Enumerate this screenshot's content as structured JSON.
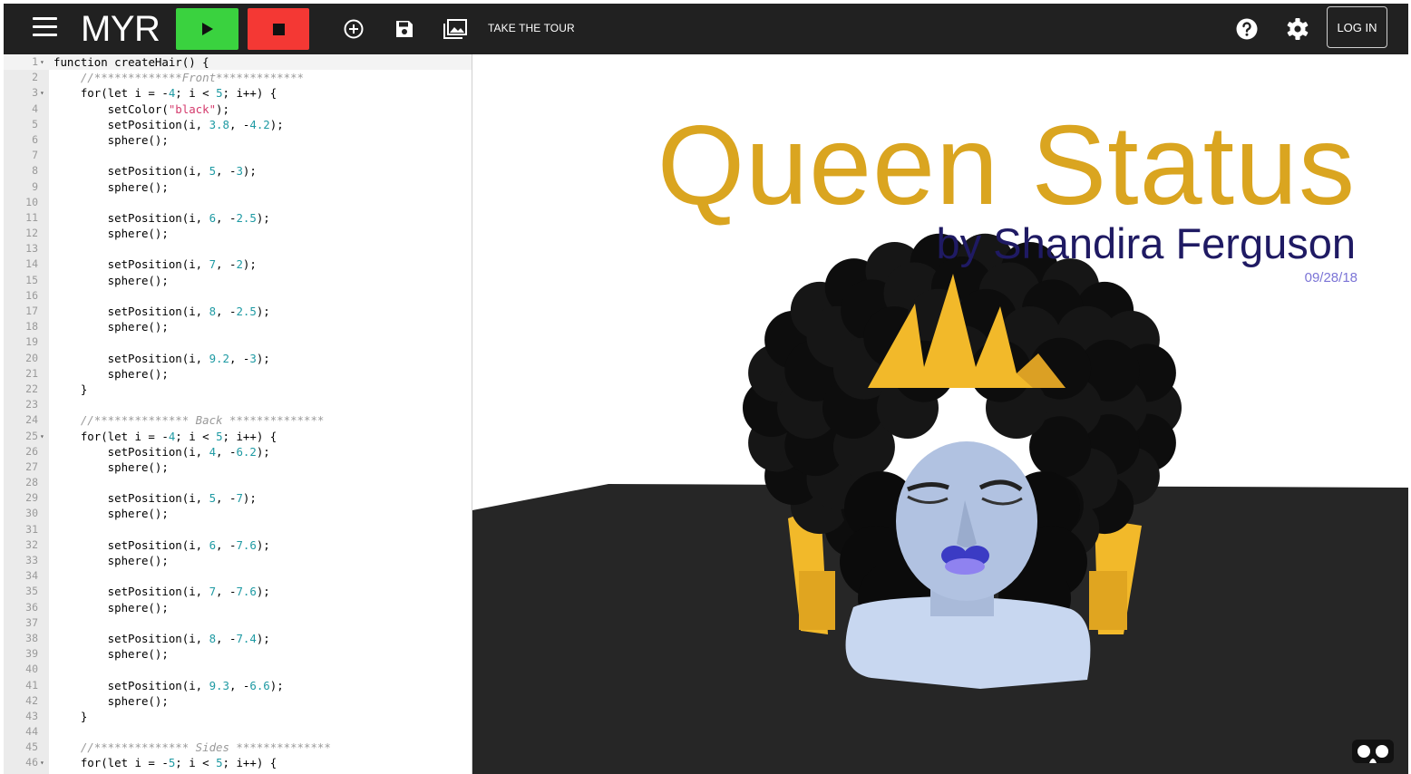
{
  "app": {
    "logo_text": "MYR"
  },
  "toolbar": {
    "menu_icon": "hamburger-menu-icon",
    "play_icon": "play-icon",
    "stop_icon": "stop-icon",
    "new_icon": "add-circle-icon",
    "save_icon": "floppy-disk-icon",
    "collection_icon": "photo-library-icon",
    "tour_label": "TAKE THE TOUR",
    "help_icon": "help-circle-icon",
    "settings_icon": "gear-icon",
    "login_label": "LOG IN",
    "colors": {
      "play": "#3ad23f",
      "stop": "#f43834",
      "bar": "#212121"
    }
  },
  "editor": {
    "active_line": 1,
    "folded_lines": [
      1,
      3,
      25,
      46
    ],
    "lines": [
      [
        [
          "kw",
          "function"
        ],
        [
          "t",
          " createHair() {"
        ]
      ],
      [
        [
          "t",
          "    "
        ],
        [
          "com",
          "//*************Front*************"
        ]
      ],
      [
        [
          "t",
          "    for(let i = -"
        ],
        [
          "num",
          "4"
        ],
        [
          "t",
          "; i < "
        ],
        [
          "num",
          "5"
        ],
        [
          "t",
          "; i++) {"
        ]
      ],
      [
        [
          "t",
          "        setColor("
        ],
        [
          "str",
          "\"black\""
        ],
        [
          "t",
          ");"
        ]
      ],
      [
        [
          "t",
          "        setPosition(i, "
        ],
        [
          "num",
          "3.8"
        ],
        [
          "t",
          ", -"
        ],
        [
          "num",
          "4.2"
        ],
        [
          "t",
          ");"
        ]
      ],
      [
        [
          "t",
          "        sphere();"
        ]
      ],
      [],
      [
        [
          "t",
          "        setPosition(i, "
        ],
        [
          "num",
          "5"
        ],
        [
          "t",
          ", -"
        ],
        [
          "num",
          "3"
        ],
        [
          "t",
          ");"
        ]
      ],
      [
        [
          "t",
          "        sphere();"
        ]
      ],
      [],
      [
        [
          "t",
          "        setPosition(i, "
        ],
        [
          "num",
          "6"
        ],
        [
          "t",
          ", -"
        ],
        [
          "num",
          "2.5"
        ],
        [
          "t",
          ");"
        ]
      ],
      [
        [
          "t",
          "        sphere();"
        ]
      ],
      [],
      [
        [
          "t",
          "        setPosition(i, "
        ],
        [
          "num",
          "7"
        ],
        [
          "t",
          ", -"
        ],
        [
          "num",
          "2"
        ],
        [
          "t",
          ");"
        ]
      ],
      [
        [
          "t",
          "        sphere();"
        ]
      ],
      [],
      [
        [
          "t",
          "        setPosition(i, "
        ],
        [
          "num",
          "8"
        ],
        [
          "t",
          ", -"
        ],
        [
          "num",
          "2.5"
        ],
        [
          "t",
          ");"
        ]
      ],
      [
        [
          "t",
          "        sphere();"
        ]
      ],
      [],
      [
        [
          "t",
          "        setPosition(i, "
        ],
        [
          "num",
          "9.2"
        ],
        [
          "t",
          ", -"
        ],
        [
          "num",
          "3"
        ],
        [
          "t",
          ");"
        ]
      ],
      [
        [
          "t",
          "        sphere();"
        ]
      ],
      [
        [
          "t",
          "    }"
        ]
      ],
      [],
      [
        [
          "t",
          "    "
        ],
        [
          "com",
          "//************** Back **************"
        ]
      ],
      [
        [
          "t",
          "    for(let i = -"
        ],
        [
          "num",
          "4"
        ],
        [
          "t",
          "; i < "
        ],
        [
          "num",
          "5"
        ],
        [
          "t",
          "; i++) {"
        ]
      ],
      [
        [
          "t",
          "        setPosition(i, "
        ],
        [
          "num",
          "4"
        ],
        [
          "t",
          ", -"
        ],
        [
          "num",
          "6.2"
        ],
        [
          "t",
          ");"
        ]
      ],
      [
        [
          "t",
          "        sphere();"
        ]
      ],
      [],
      [
        [
          "t",
          "        setPosition(i, "
        ],
        [
          "num",
          "5"
        ],
        [
          "t",
          ", -"
        ],
        [
          "num",
          "7"
        ],
        [
          "t",
          ");"
        ]
      ],
      [
        [
          "t",
          "        sphere();"
        ]
      ],
      [],
      [
        [
          "t",
          "        setPosition(i, "
        ],
        [
          "num",
          "6"
        ],
        [
          "t",
          ", -"
        ],
        [
          "num",
          "7.6"
        ],
        [
          "t",
          ");"
        ]
      ],
      [
        [
          "t",
          "        sphere();"
        ]
      ],
      [],
      [
        [
          "t",
          "        setPosition(i, "
        ],
        [
          "num",
          "7"
        ],
        [
          "t",
          ", -"
        ],
        [
          "num",
          "7.6"
        ],
        [
          "t",
          ");"
        ]
      ],
      [
        [
          "t",
          "        sphere();"
        ]
      ],
      [],
      [
        [
          "t",
          "        setPosition(i, "
        ],
        [
          "num",
          "8"
        ],
        [
          "t",
          ", -"
        ],
        [
          "num",
          "7.4"
        ],
        [
          "t",
          ");"
        ]
      ],
      [
        [
          "t",
          "        sphere();"
        ]
      ],
      [],
      [
        [
          "t",
          "        setPosition(i, "
        ],
        [
          "num",
          "9.3"
        ],
        [
          "t",
          ", -"
        ],
        [
          "num",
          "6.6"
        ],
        [
          "t",
          ");"
        ]
      ],
      [
        [
          "t",
          "        sphere();"
        ]
      ],
      [
        [
          "t",
          "    }"
        ]
      ],
      [],
      [
        [
          "t",
          "    "
        ],
        [
          "com",
          "//************** Sides **************"
        ]
      ],
      [
        [
          "t",
          "    for(let i = -"
        ],
        [
          "num",
          "5"
        ],
        [
          "t",
          "; i < "
        ],
        [
          "num",
          "5"
        ],
        [
          "t",
          "; i++) {"
        ]
      ]
    ]
  },
  "scene": {
    "title": "Queen Status",
    "byline": "by Shandira Ferguson",
    "date": "09/28/18",
    "vr_icon": "vr-headset-icon",
    "colors": {
      "title": "#daa520",
      "byline": "#1f1a63",
      "date": "#7b74d6",
      "floor": "#262626",
      "gold": "#f2b92a",
      "skin": "#b4c4e4",
      "lips": "#4a4ad0"
    }
  }
}
